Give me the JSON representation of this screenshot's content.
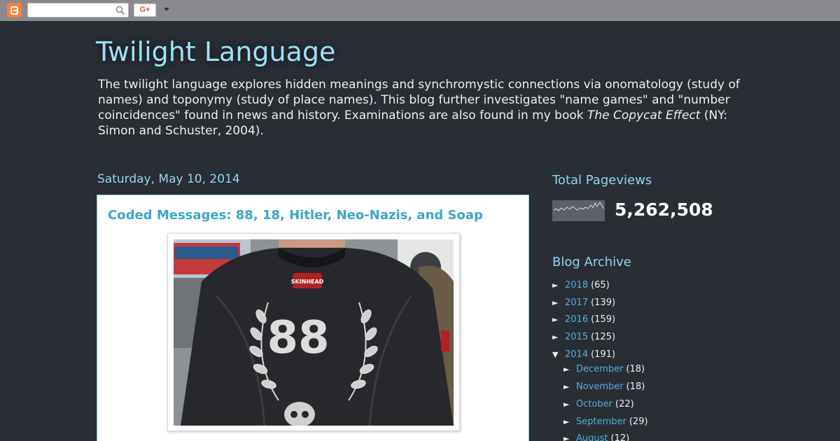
{
  "navbar": {
    "logo_icon": "blogger-logo-icon",
    "search_icon": "search-icon",
    "gplus_label": "G+",
    "more_icon": "caret-down-icon"
  },
  "header": {
    "title": "Twilight Language",
    "description_part1": "The twilight language explores hidden meanings and synchromystic connections via onomatology (study of names) and toponymy (study of place names). This blog further investigates \"name games\" and \"number coincidences\" found in news and history. Examinations are also found in my book ",
    "description_book": "The Copycat Effect",
    "description_part2": " (NY: Simon and Schuster, 2004)."
  },
  "post": {
    "date": "Saturday, May 10, 2014",
    "title": "Coded Messages: 88, 18, Hitler, Neo-Nazis, and Soap",
    "photo": {
      "patch_text": "SKINHEAD",
      "number_text": "88"
    }
  },
  "sidebar": {
    "pageviews_title": "Total Pageviews",
    "pageviews_count": "5,262,508",
    "archive_title": "Blog Archive",
    "years": [
      {
        "toggle": "►",
        "year": "2018",
        "count": "(65)"
      },
      {
        "toggle": "►",
        "year": "2017",
        "count": "(139)"
      },
      {
        "toggle": "►",
        "year": "2016",
        "count": "(159)"
      },
      {
        "toggle": "►",
        "year": "2015",
        "count": "(125)"
      },
      {
        "toggle": "▼",
        "year": "2014",
        "count": "(191)"
      }
    ],
    "months": [
      {
        "toggle": "►",
        "month": "December",
        "count": "(18)"
      },
      {
        "toggle": "►",
        "month": "November",
        "count": "(18)"
      },
      {
        "toggle": "►",
        "month": "October",
        "count": "(22)"
      },
      {
        "toggle": "►",
        "month": "September",
        "count": "(29)"
      },
      {
        "toggle": "►",
        "month": "August",
        "count": "(12)"
      }
    ]
  },
  "colors": {
    "background": "#292d34",
    "title": "#9be1f7",
    "link": "#4fb0d6",
    "post_title": "#3ba5cc"
  }
}
